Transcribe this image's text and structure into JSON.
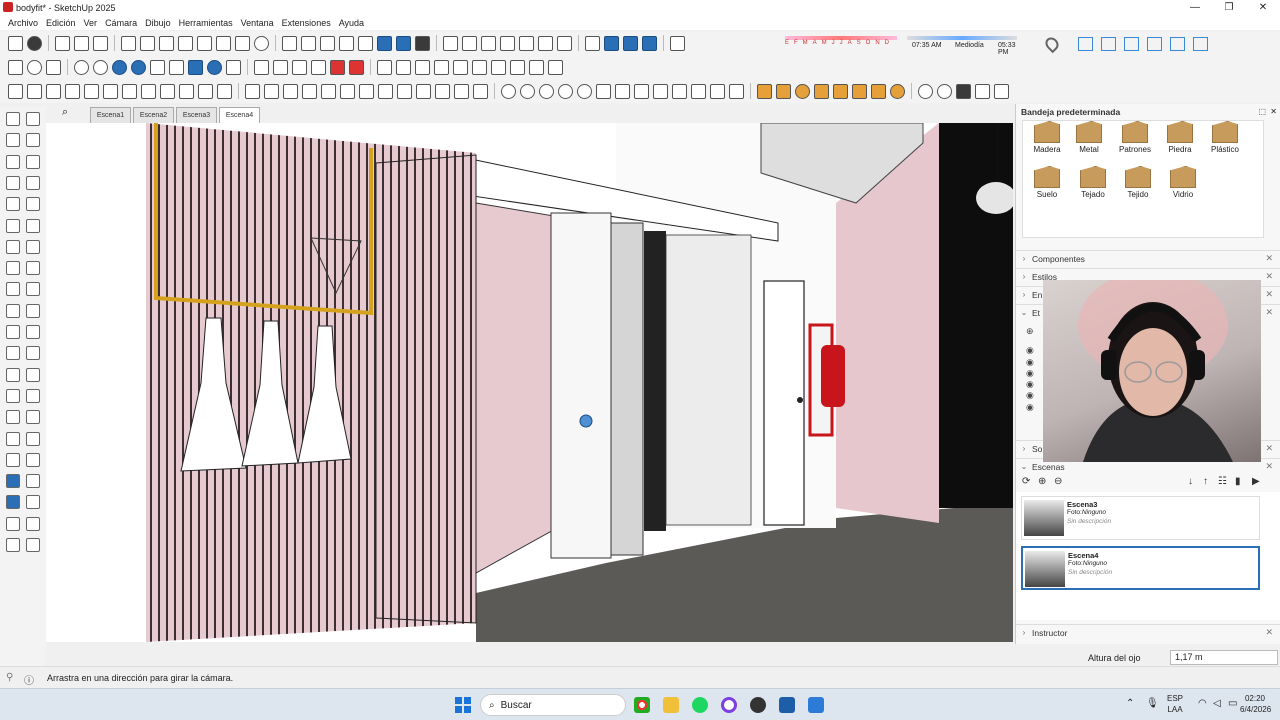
{
  "window": {
    "title": "bodyfit* - SketchUp 2025",
    "minimize": "—",
    "maximize": "❐",
    "close": "✕"
  },
  "menu": [
    "Archivo",
    "Edición",
    "Ver",
    "Cámara",
    "Dibujo",
    "Herramientas",
    "Ventana",
    "Extensiones",
    "Ayuda"
  ],
  "shadows": {
    "months": "EFMAMJJASOND",
    "time_start": "07:35 AM",
    "midday": "Mediodía",
    "time_end": "05:33 PM"
  },
  "scenes": {
    "tabs": [
      "Escena1",
      "Escena2",
      "Escena3",
      "Escena4"
    ],
    "active": "Escena4"
  },
  "tray_panel": {
    "title": "Bandeja predeterminada",
    "materials": [
      "Madera",
      "Metal",
      "Patrones",
      "Piedra",
      "Plástico",
      "Suelo",
      "Tejado",
      "Tejido",
      "Vidrio"
    ],
    "sections": {
      "componentes": "Componentes",
      "estilos": "Estilos",
      "en": "En",
      "et": "Et",
      "so": "So",
      "escenas": "Escenas",
      "instructor": "Instructor"
    },
    "scene_cards": [
      {
        "name": "Escena3",
        "photo_label": "Foto:",
        "photo_value": "Ninguno",
        "desc": "Sin descripción"
      },
      {
        "name": "Escena4",
        "photo_label": "Foto:",
        "photo_value": "Ninguno",
        "desc": "Sin descripción"
      }
    ]
  },
  "status": {
    "message": "Arrastra en una dirección para girar la cámara.",
    "measure_label": "Altura del ojo",
    "measure_value": "1,17 m"
  },
  "taskbar": {
    "search": "Buscar",
    "lang1": "ESP",
    "lang2": "LAA",
    "time": "02:20",
    "date": "6/4/2026"
  },
  "colors": {
    "accent": "#2a6fb5",
    "wall_pink": "#e7c9d0",
    "floor": "#5c5a57",
    "extinguisher": "#c8141b"
  }
}
